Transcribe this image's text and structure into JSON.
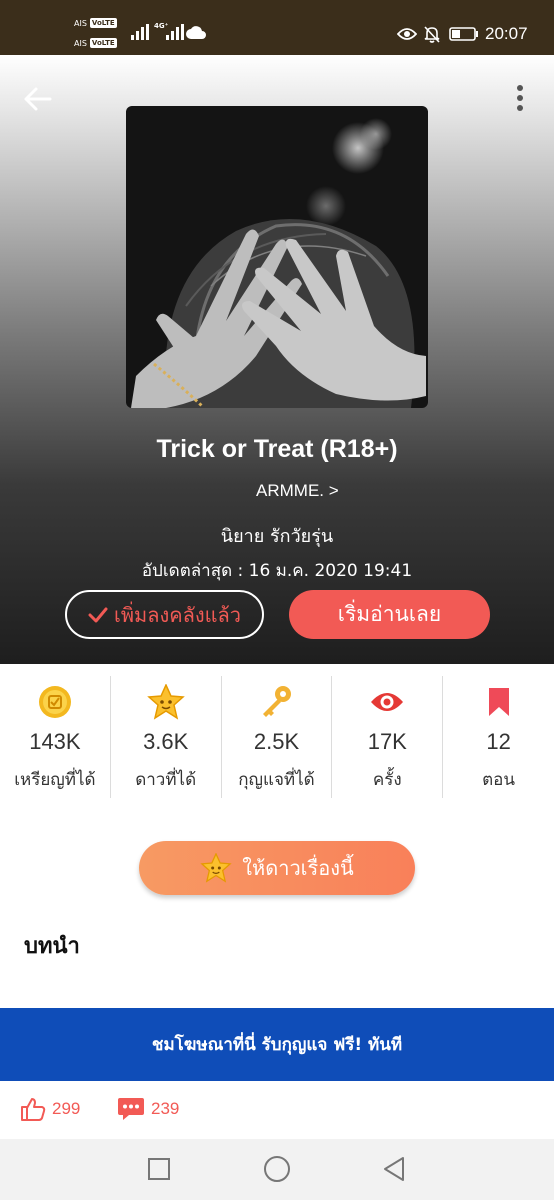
{
  "status_bar": {
    "carrier_1": "AIS",
    "carrier_2": "AIS",
    "volte_badge": "VoLTE",
    "network_badge": "4G⁺",
    "time": "20:07",
    "icons": [
      "signal-icon",
      "cloud-icon",
      "eye-icon",
      "bell-off-icon",
      "battery-icon"
    ]
  },
  "header": {
    "back_icon": "arrow-left-icon",
    "menu_icon": "more-vertical-icon"
  },
  "novel": {
    "title": "Trick or Treat (R18+)",
    "author": "ARMME. >",
    "genre": "นิยาย รักวัยรุ่น",
    "updated": "อัปเดตล่าสุด : 16 ม.ค. 2020 19:41"
  },
  "actions": {
    "library_label": "เพิ่มลงคลังแล้ว",
    "read_label": "เริ่มอ่านเลย",
    "give_star_label": "ให้ดาวเรื่องนี้"
  },
  "stats": [
    {
      "icon": "coin-icon",
      "value": "143K",
      "label": "เหรียญที่ได้"
    },
    {
      "icon": "star-icon",
      "value": "3.6K",
      "label": "ดาวที่ได้"
    },
    {
      "icon": "key-icon",
      "value": "2.5K",
      "label": "กุญแจที่ได้"
    },
    {
      "icon": "eye-icon",
      "value": "17K",
      "label": "ครั้ง"
    },
    {
      "icon": "bookmark-icon",
      "value": "12",
      "label": "ตอน"
    }
  ],
  "intro": {
    "heading": "บทนำ"
  },
  "ad_banner": {
    "text": "ชมโฆษณาที่นี่ รับกุญแจ ฟรี! ทันที"
  },
  "social": {
    "likes": "299",
    "comments": "239"
  },
  "colors": {
    "accent": "#f25a55",
    "status_bar": "#3b2e1b",
    "ad_banner": "#0f4db8",
    "star_button": "#f79a63"
  }
}
